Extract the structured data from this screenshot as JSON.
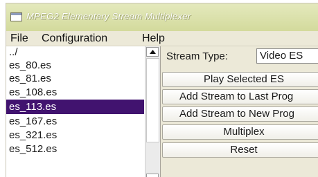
{
  "window": {
    "title": "MPEG2 Elementary Stream Multiplexer"
  },
  "menubar": {
    "items": [
      {
        "label": "File"
      },
      {
        "label": "Configuration"
      },
      {
        "label": "Help"
      }
    ]
  },
  "file_list": {
    "items": [
      {
        "label": "../",
        "selected": false
      },
      {
        "label": "es_80.es",
        "selected": false
      },
      {
        "label": "es_81.es",
        "selected": false
      },
      {
        "label": "es_108.es",
        "selected": false
      },
      {
        "label": "es_113.es",
        "selected": true
      },
      {
        "label": "es_167.es",
        "selected": false
      },
      {
        "label": "es_321.es",
        "selected": false
      },
      {
        "label": "es_512.es",
        "selected": false
      }
    ]
  },
  "controls": {
    "stream_type_label": "Stream Type:",
    "stream_type_value": "Video ES",
    "buttons": [
      {
        "label": "Play Selected ES"
      },
      {
        "label": "Add Stream to Last Prog"
      },
      {
        "label": "Add Stream to New Prog"
      },
      {
        "label": "Multiplex"
      },
      {
        "label": "Reset"
      }
    ]
  },
  "colors": {
    "selection": "#41136f",
    "titlebar": "#d3da9c",
    "window_bg": "#ece9d8"
  },
  "icons": [
    "window-icon",
    "scroll-up-arrow-icon"
  ]
}
